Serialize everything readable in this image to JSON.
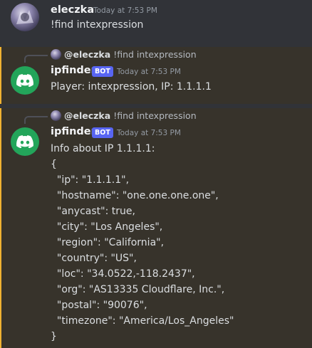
{
  "messages": [
    {
      "author": "eleczka",
      "timestamp": "Today at 7:53 PM",
      "content": "!find intexpression"
    },
    {
      "reply": {
        "author": "@eleczka",
        "text": "!find intexpression"
      },
      "author": "ipfinder",
      "badge": "BOT",
      "timestamp": "Today at 7:53 PM",
      "content": "Player: intexpression, IP: 1.1.1.1"
    },
    {
      "reply": {
        "author": "@eleczka",
        "text": "!find intexpression"
      },
      "author": "ipfinder",
      "badge": "BOT",
      "timestamp": "Today at 7:53 PM",
      "content_lines": [
        "Info about IP 1.1.1.1:",
        "{",
        "  \"ip\": \"1.1.1.1\",",
        "  \"hostname\": \"one.one.one.one\",",
        "  \"anycast\": true,",
        "  \"city\": \"Los Angeles\",",
        "  \"region\": \"California\",",
        "  \"country\": \"US\",",
        "  \"loc\": \"34.0522,-118.2437\",",
        "  \"org\": \"AS13335 Cloudflare, Inc.\",",
        "  \"postal\": \"90076\",",
        "  \"timezone\": \"America/Los_Angeles\"",
        "}"
      ]
    }
  ],
  "colors": {
    "background": "#313338",
    "highlight": "#37332b",
    "highlight_bar": "#f0b232",
    "bot_badge": "#5865f2",
    "bot_avatar": "#23a55a"
  },
  "icons": {
    "bot_avatar": "discord-logo-icon",
    "user_avatar": "user-avatar-image"
  }
}
